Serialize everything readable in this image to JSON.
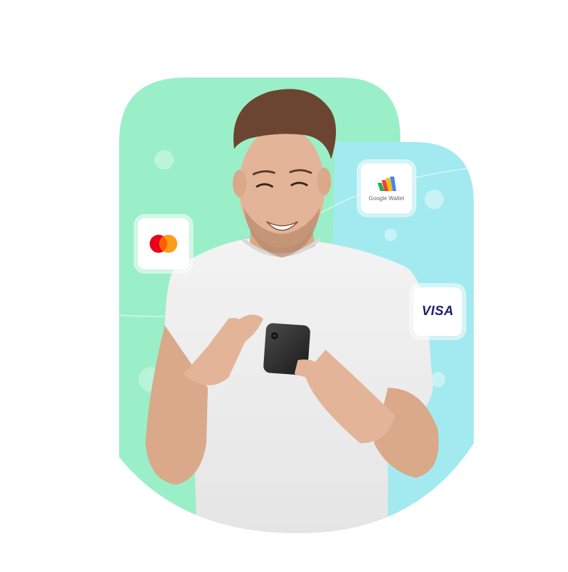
{
  "image": {
    "subject": "young man smiling at smartphone",
    "background_colors": {
      "mint": "#9BEFC8",
      "sky": "#A3EAF0"
    }
  },
  "badges": {
    "mastercard": {
      "icon": "mastercard-logo-icon",
      "colors": [
        "#EB001B",
        "#F79E1B"
      ]
    },
    "google_wallet": {
      "icon": "google-wallet-logo-icon",
      "label": "Google Wallet"
    },
    "visa": {
      "icon": "visa-logo-icon",
      "label": "VISA",
      "color": "#1A1F71"
    }
  }
}
